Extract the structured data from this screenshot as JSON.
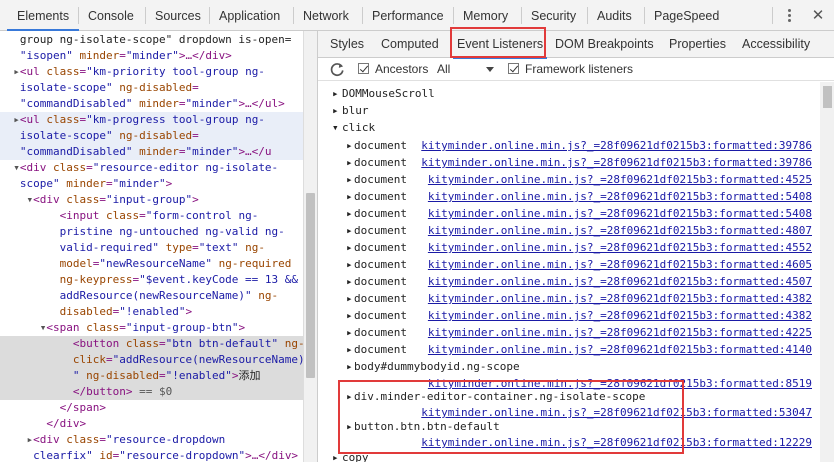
{
  "toolbar": {
    "tabs": [
      "Elements",
      "Console",
      "Sources",
      "Application",
      "Network",
      "Performance",
      "Memory",
      "Security",
      "Audits",
      "PageSpeed"
    ],
    "active_tab": "Elements",
    "more_icon": "kebab-menu-icon",
    "close_label": "✕"
  },
  "elements_panel": {
    "lines": [
      {
        "indent": "  ",
        "tri": "",
        "html": [
          [
            "tx",
            "group ng-isolate-scope\" dropdown is-open="
          ]
        ],
        "state": ""
      },
      {
        "indent": "  ",
        "tri": "",
        "html": [
          [
            "av",
            "\"isopen\""
          ],
          [
            "an",
            " minder"
          ],
          [
            "eq",
            "="
          ],
          [
            "av",
            "\"minder\""
          ],
          [
            "tag",
            ">…</div>"
          ]
        ],
        "state": ""
      },
      {
        "indent": "  ",
        "tri": "▸",
        "html": [
          [
            "tag",
            "<ul"
          ],
          [
            "an",
            " class"
          ],
          [
            "eq",
            "="
          ],
          [
            "av",
            "\"km-priority tool-group ng-"
          ]
        ],
        "state": ""
      },
      {
        "indent": "  ",
        "tri": "",
        "html": [
          [
            "av",
            "isolate-scope\""
          ],
          [
            "an",
            " ng-disabled"
          ],
          [
            "eq",
            "="
          ]
        ],
        "state": ""
      },
      {
        "indent": "  ",
        "tri": "",
        "html": [
          [
            "av",
            "\"commandDisabled\""
          ],
          [
            "an",
            " minder"
          ],
          [
            "eq",
            "="
          ],
          [
            "av",
            "\"minder\""
          ],
          [
            "tag",
            ">…</ul>"
          ]
        ],
        "state": ""
      },
      {
        "indent": "  ",
        "tri": "▸",
        "html": [
          [
            "tag",
            "<ul"
          ],
          [
            "an",
            " class"
          ],
          [
            "eq",
            "="
          ],
          [
            "av",
            "\"km-progress tool-group ng-"
          ]
        ],
        "state": "hov"
      },
      {
        "indent": "  ",
        "tri": "",
        "html": [
          [
            "av",
            "isolate-scope\""
          ],
          [
            "an",
            " ng-disabled"
          ],
          [
            "eq",
            "="
          ]
        ],
        "state": "hov"
      },
      {
        "indent": "  ",
        "tri": "",
        "html": [
          [
            "av",
            "\"commandDisabled\""
          ],
          [
            "an",
            " minder"
          ],
          [
            "eq",
            "="
          ],
          [
            "av",
            "\"minder\""
          ],
          [
            "tag",
            ">…</u"
          ]
        ],
        "state": "hov"
      },
      {
        "indent": "  ",
        "tri": "▾",
        "html": [
          [
            "tag",
            "<div"
          ],
          [
            "an",
            " class"
          ],
          [
            "eq",
            "="
          ],
          [
            "av",
            "\"resource-editor ng-isolate-"
          ]
        ],
        "state": ""
      },
      {
        "indent": "  ",
        "tri": "",
        "html": [
          [
            "av",
            "scope\""
          ],
          [
            "an",
            " minder"
          ],
          [
            "eq",
            "="
          ],
          [
            "av",
            "\"minder\""
          ],
          [
            "tag",
            ">"
          ]
        ],
        "state": ""
      },
      {
        "indent": "    ",
        "tri": "▾",
        "html": [
          [
            "tag",
            "<div"
          ],
          [
            "an",
            " class"
          ],
          [
            "eq",
            "="
          ],
          [
            "av",
            "\"input-group\""
          ],
          [
            "tag",
            ">"
          ]
        ],
        "state": ""
      },
      {
        "indent": "        ",
        "tri": "",
        "html": [
          [
            "tag",
            "<input"
          ],
          [
            "an",
            " class"
          ],
          [
            "eq",
            "="
          ],
          [
            "av",
            "\"form-control ng-"
          ]
        ],
        "state": ""
      },
      {
        "indent": "        ",
        "tri": "",
        "html": [
          [
            "av",
            "pristine ng-untouched ng-valid ng-"
          ]
        ],
        "state": ""
      },
      {
        "indent": "        ",
        "tri": "",
        "html": [
          [
            "av",
            "valid-required\""
          ],
          [
            "an",
            " type"
          ],
          [
            "eq",
            "="
          ],
          [
            "av",
            "\"text\""
          ],
          [
            "an",
            " ng-"
          ]
        ],
        "state": ""
      },
      {
        "indent": "        ",
        "tri": "",
        "html": [
          [
            "an",
            "model"
          ],
          [
            "eq",
            "="
          ],
          [
            "av",
            "\"newResourceName\""
          ],
          [
            "an",
            " ng-required"
          ]
        ],
        "state": ""
      },
      {
        "indent": "        ",
        "tri": "",
        "html": [
          [
            "an",
            "ng-keypress"
          ],
          [
            "eq",
            "="
          ],
          [
            "av",
            "\"$event.keyCode == 13 &&"
          ]
        ],
        "state": ""
      },
      {
        "indent": "        ",
        "tri": "",
        "html": [
          [
            "av",
            "addResource(newResourceName)\""
          ],
          [
            "an",
            " ng-"
          ]
        ],
        "state": ""
      },
      {
        "indent": "        ",
        "tri": "",
        "html": [
          [
            "an",
            "disabled"
          ],
          [
            "eq",
            "="
          ],
          [
            "av",
            "\"!enabled\""
          ],
          [
            "tag",
            ">"
          ]
        ],
        "state": ""
      },
      {
        "indent": "      ",
        "tri": "▾",
        "html": [
          [
            "tag",
            "<span"
          ],
          [
            "an",
            " class"
          ],
          [
            "eq",
            "="
          ],
          [
            "av",
            "\"input-group-btn\""
          ],
          [
            "tag",
            ">"
          ]
        ],
        "state": ""
      },
      {
        "indent": "          ",
        "tri": "",
        "html": [
          [
            "tag",
            "<button"
          ],
          [
            "an",
            " class"
          ],
          [
            "eq",
            "="
          ],
          [
            "av",
            "\"btn btn-default\""
          ],
          [
            "an",
            " ng-"
          ]
        ],
        "state": "sel"
      },
      {
        "indent": "          ",
        "tri": "",
        "html": [
          [
            "an",
            "click"
          ],
          [
            "eq",
            "="
          ],
          [
            "av",
            "\"addResource(newResourceName)"
          ]
        ],
        "state": "sel"
      },
      {
        "indent": "          ",
        "tri": "",
        "html": [
          [
            "av",
            "\""
          ],
          [
            "an",
            " ng-disabled"
          ],
          [
            "eq",
            "="
          ],
          [
            "av",
            "\"!enabled\""
          ],
          [
            "tag",
            ">"
          ],
          [
            "tx",
            "添加"
          ]
        ],
        "state": "sel"
      },
      {
        "indent": "          ",
        "tri": "",
        "html": [
          [
            "tag",
            "</button>"
          ],
          [
            "cm",
            " == $0"
          ]
        ],
        "state": "sel"
      },
      {
        "indent": "        ",
        "tri": "",
        "html": [
          [
            "tag",
            "</span>"
          ]
        ],
        "state": ""
      },
      {
        "indent": "      ",
        "tri": "",
        "html": [
          [
            "tag",
            "</div>"
          ]
        ],
        "state": ""
      },
      {
        "indent": "    ",
        "tri": "▸",
        "html": [
          [
            "tag",
            "<div"
          ],
          [
            "an",
            " class"
          ],
          [
            "eq",
            "="
          ],
          [
            "av",
            "\"resource-dropdown"
          ]
        ],
        "state": ""
      },
      {
        "indent": "    ",
        "tri": "",
        "html": [
          [
            "av",
            "clearfix\""
          ],
          [
            "an",
            " id"
          ],
          [
            "eq",
            "="
          ],
          [
            "av",
            "\"resource-dropdown\""
          ],
          [
            "tag",
            ">…</div>"
          ]
        ],
        "state": ""
      },
      {
        "indent": "    ",
        "tri": "",
        "html": [
          [
            "tag",
            "</div>"
          ]
        ],
        "state": ""
      }
    ]
  },
  "sidebar": {
    "tabs": [
      "Styles",
      "Computed",
      "Event Listeners",
      "DOM Breakpoints",
      "Properties",
      "Accessibility"
    ],
    "active_tab": "Event Listeners"
  },
  "listener_toolbar": {
    "refresh_icon": "refresh-icon",
    "ancestors_label": "Ancestors",
    "ancestors_checked": true,
    "filter_value": "All",
    "framework_label": "Framework listeners",
    "framework_checked": true
  },
  "listeners": {
    "groups": [
      {
        "name": "DOMMouseScroll",
        "expanded": false
      },
      {
        "name": "blur",
        "expanded": false
      },
      {
        "name": "click",
        "expanded": true
      }
    ],
    "click_items": [
      {
        "target": "document",
        "location": "kityminder.online.min.js?_=28f09621df0215b3:formatted:39786"
      },
      {
        "target": "document",
        "location": "kityminder.online.min.js?_=28f09621df0215b3:formatted:39786"
      },
      {
        "target": "document",
        "location": "kityminder.online.min.js?_=28f09621df0215b3:formatted:4525"
      },
      {
        "target": "document",
        "location": "kityminder.online.min.js?_=28f09621df0215b3:formatted:5408"
      },
      {
        "target": "document",
        "location": "kityminder.online.min.js?_=28f09621df0215b3:formatted:5408"
      },
      {
        "target": "document",
        "location": "kityminder.online.min.js?_=28f09621df0215b3:formatted:4807"
      },
      {
        "target": "document",
        "location": "kityminder.online.min.js?_=28f09621df0215b3:formatted:4552"
      },
      {
        "target": "document",
        "location": "kityminder.online.min.js?_=28f09621df0215b3:formatted:4605"
      },
      {
        "target": "document",
        "location": "kityminder.online.min.js?_=28f09621df0215b3:formatted:4507"
      },
      {
        "target": "document",
        "location": "kityminder.online.min.js?_=28f09621df0215b3:formatted:4382"
      },
      {
        "target": "document",
        "location": "kityminder.online.min.js?_=28f09621df0215b3:formatted:4382"
      },
      {
        "target": "document",
        "location": "kityminder.online.min.js?_=28f09621df0215b3:formatted:4225"
      },
      {
        "target": "document",
        "location": "kityminder.online.min.js?_=28f09621df0215b3:formatted:4140"
      }
    ],
    "body_item": {
      "target": "body#dummybodyid.ng-scope",
      "location": "kityminder.online.min.js?_=28f09621df0215b3:formatted:8519"
    },
    "editor_item": {
      "target": "div.minder-editor-container.ng-isolate-scope",
      "location": "kityminder.online.min.js?_=28f09621df0215b3:formatted:53047"
    },
    "button_item": {
      "target": "button.btn.btn-default",
      "location": "kityminder.online.min.js?_=28f09621df0215b3:formatted:12229"
    },
    "copy_group": {
      "name": "copy"
    }
  },
  "colors": {
    "highlight_box": "#e13a3a",
    "active_tab_underline": "#3879d9",
    "link": "#1a1aa6"
  }
}
